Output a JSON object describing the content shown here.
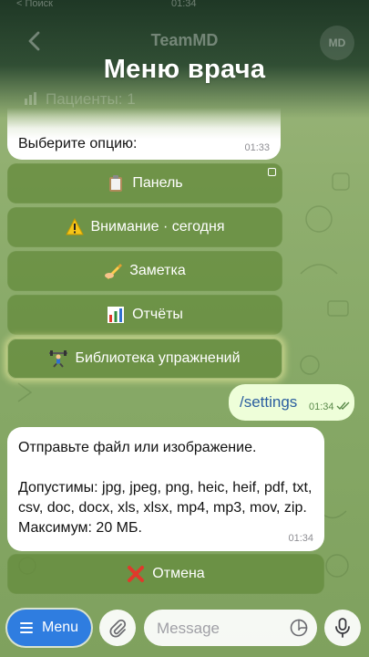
{
  "status_bar": {
    "time": "01:34",
    "left": "< Поиск"
  },
  "header": {
    "back_label": "",
    "chat_title": "TeamMD",
    "avatar_initials": "MD",
    "overlay_title": "Меню врача",
    "pinned_text": "Пациенты: 1"
  },
  "messages": {
    "choose": {
      "text": "Выберите опцию:",
      "time": "01:33"
    },
    "keyboard": [
      {
        "emoji": "clipboard",
        "label": "Панель"
      },
      {
        "emoji": "warning",
        "label": "Внимание · сегодня"
      },
      {
        "emoji": "writing-hand",
        "label": "Заметка"
      },
      {
        "emoji": "bar-chart",
        "label": "Отчёты"
      },
      {
        "emoji": "weightlifter",
        "label": "Библиотека упражнений"
      }
    ],
    "outgoing": {
      "text": "/settings",
      "time": "01:34"
    },
    "file_prompt": {
      "line1": "Отправьте файл или изображение.",
      "line2": "Допустимы: jpg, jpeg, png, heic, heif, pdf, txt, csv, doc, docx, xls, xlsx, mp4, mp3, mov, zip. Максимум: 20 МБ.",
      "time": "01:34"
    },
    "cancel": {
      "emoji": "cross-mark",
      "label": "Отмена"
    }
  },
  "input_bar": {
    "menu_label": "Menu",
    "placeholder": "Message"
  },
  "colors": {
    "accent": "#2f7de0",
    "button_green": "#658c3e",
    "outgoing_bubble": "#eefed9",
    "warning": "#f5c518",
    "cancel_red": "#e0392b"
  }
}
